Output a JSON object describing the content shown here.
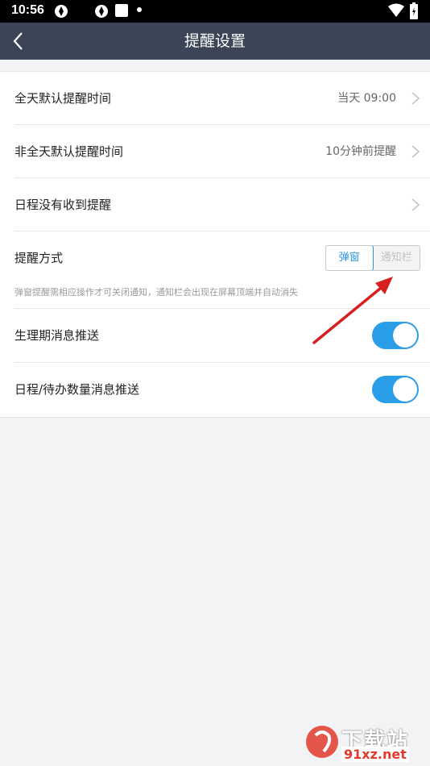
{
  "status_bar": {
    "time": "10:56"
  },
  "header": {
    "title": "提醒设置"
  },
  "settings": {
    "all_day": {
      "label": "全天默认提醒时间",
      "value": "当天 09:00"
    },
    "not_all_day": {
      "label": "非全天默认提醒时间",
      "value": "10分钟前提醒"
    },
    "no_reminder": {
      "label": "日程没有收到提醒"
    },
    "method": {
      "label": "提醒方式",
      "options": [
        "弹窗",
        "通知栏"
      ],
      "selected": "弹窗",
      "hint": "弹窗提醒需相应操作才可关闭通知，通知栏会出现在屏幕顶端并自动消失"
    },
    "period_push": {
      "label": "生理期消息推送",
      "enabled": true
    },
    "todo_push": {
      "label": "日程/待办数量消息推送",
      "enabled": true
    }
  },
  "watermark": {
    "top": "下载站",
    "bottom": "91xz.net"
  },
  "colors": {
    "header_bg": "#3b4557",
    "accent": "#2a9de8",
    "annotation_arrow": "#d62020"
  }
}
